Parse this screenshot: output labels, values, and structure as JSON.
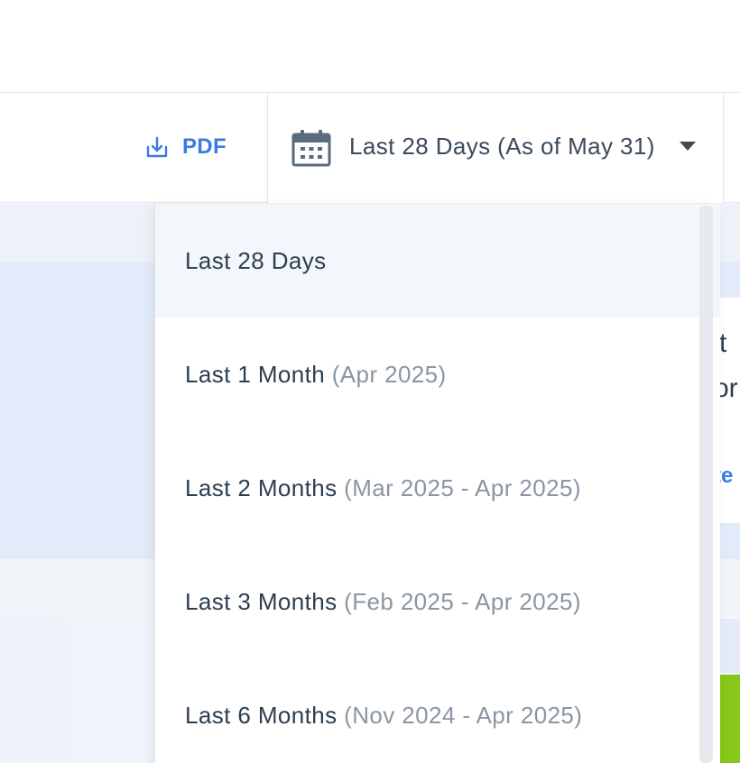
{
  "toolbar": {
    "pdf_label": "PDF",
    "date_range_label": "Last 28 Days (As of May 31)"
  },
  "dropdown": {
    "items": [
      {
        "label": "Last 28 Days",
        "sub": "",
        "active": true
      },
      {
        "label": "Last 1 Month",
        "sub": "(Apr 2025)"
      },
      {
        "label": "Last 2 Months",
        "sub": "(Mar 2025 - Apr 2025)"
      },
      {
        "label": "Last 3 Months",
        "sub": "(Feb 2025 - Apr 2025)"
      },
      {
        "label": "Last 6 Months",
        "sub": "(Nov 2024 - Apr 2025)"
      }
    ]
  },
  "background": {
    "card_text_1": "t",
    "card_text_2": "or",
    "card_link": "te"
  },
  "colors": {
    "accent": "#3b7ae6",
    "text": "#2c3e50",
    "muted": "#8a96a4",
    "active_bg": "#f3f6fb",
    "green": "#86c71a"
  },
  "icons": {
    "pdf": "download-icon",
    "date": "calendar-icon",
    "caret": "caret-down-icon"
  }
}
